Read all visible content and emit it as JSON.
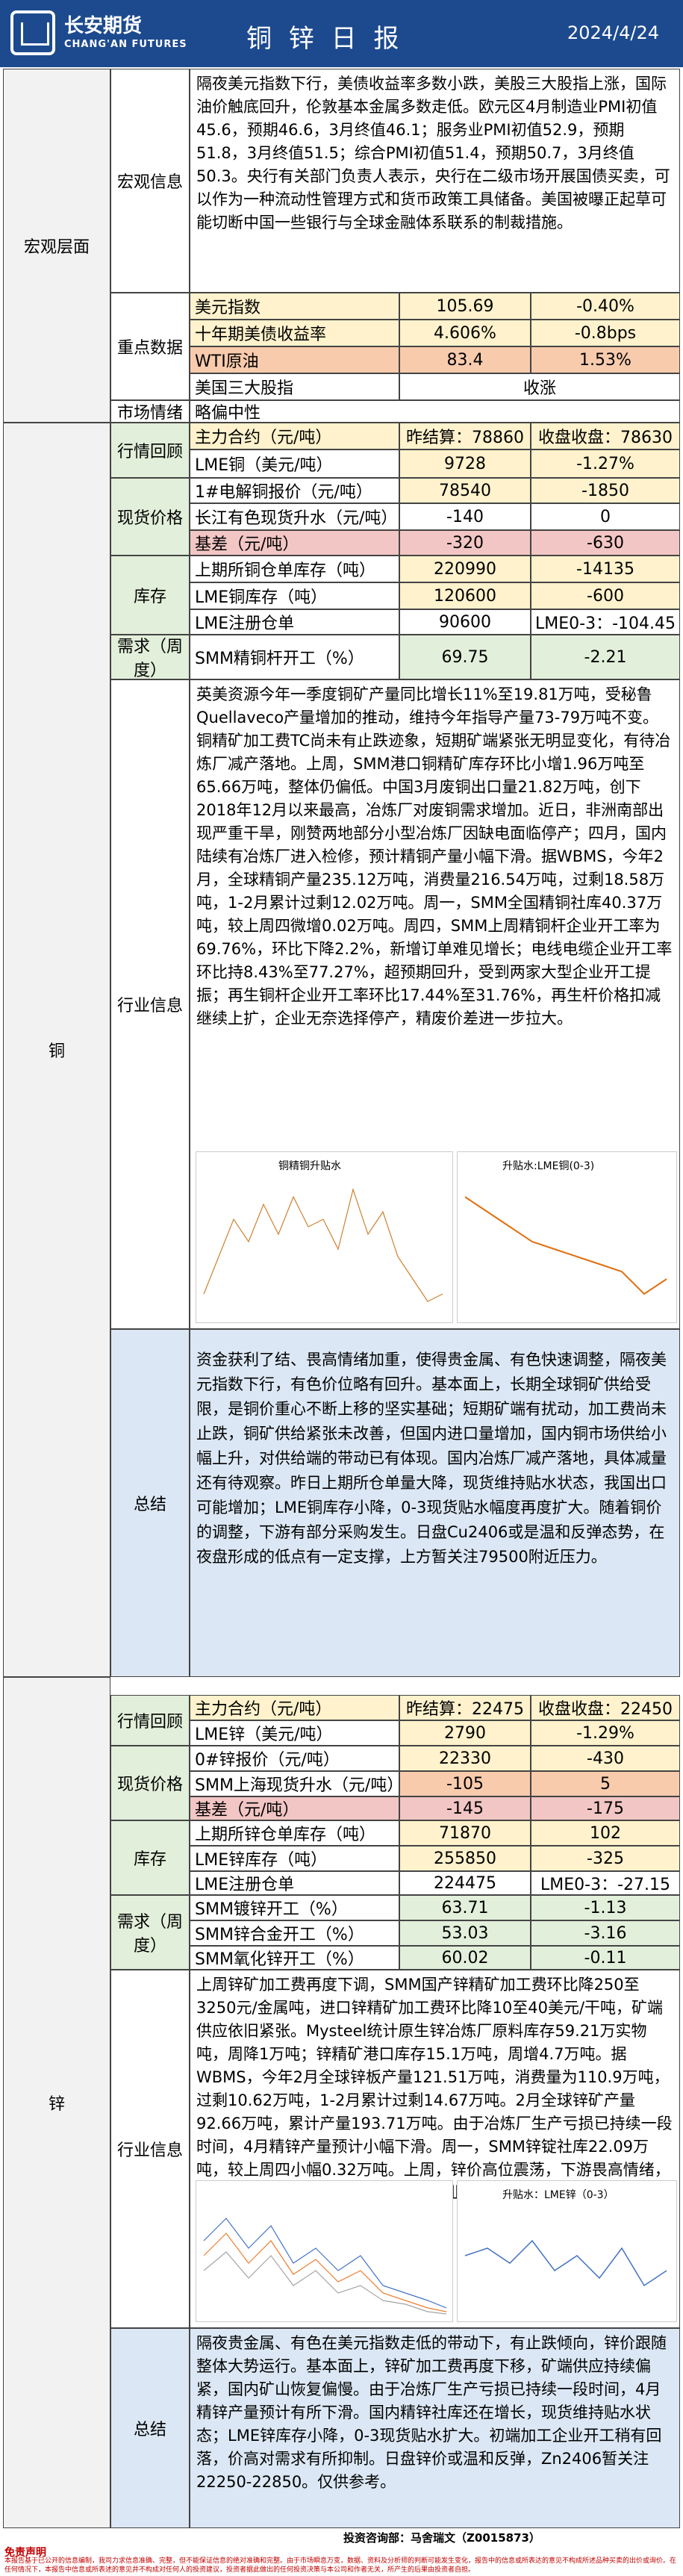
{
  "header": {
    "brand_cn": "长安期货",
    "brand_en": "CHANG'AN FUTURES",
    "title": "铜 锌 日 报",
    "date": "2024/4/24"
  },
  "macro": {
    "section": "宏观层面",
    "info_label": "宏观信息",
    "info_text": "隔夜美元指数下行，美债收益率多数小跌，美股三大股指上涨，国际油价触底回升，伦敦基本金属多数走低。欧元区4月制造业PMI初值45.6，预期46.6，3月终值46.1；服务业PMI初值52.9，预期51.8，3月终值51.5；综合PMI初值51.4，预期50.7，3月终值50.3。央行有关部门负责人表示，央行在二级市场开展国债买卖，可以作为一种流动性管理方式和货币政策工具储备。美国被曝正起草可能切断中国一些银行与全球金融体系联系的制裁措施。",
    "data_label": "重点数据",
    "rows": [
      {
        "name": "美元指数",
        "value": "105.69",
        "change": "-0.40%"
      },
      {
        "name": "十年期美债收益率",
        "value": "4.606%",
        "change": "-0.8bps"
      },
      {
        "name": "WTI原油",
        "value": "83.4",
        "change": "1.53%"
      },
      {
        "name": "美国三大股指",
        "value": "",
        "change": "收涨"
      }
    ],
    "sentiment_label": "市场情绪",
    "sentiment_value": "略偏中性"
  },
  "copper": {
    "section": "铜",
    "review_label": "行情回顾",
    "main_contract": "主力合约（元/吨）",
    "yclose_label": "昨结算：78860",
    "close_label": "收盘收盘：78630",
    "lme_label": "LME铜（美元/吨）",
    "lme_value": "9728",
    "lme_change": "-1.27%",
    "spot_label": "现货价格",
    "spot_rows": [
      {
        "name": "1#电解铜报价（元/吨）",
        "value": "78540",
        "change": "-1850"
      },
      {
        "name": "长江有色现货升水（元/吨）",
        "value": "-140",
        "change": "0"
      },
      {
        "name": "基差（元/吨）",
        "value": "-320",
        "change": "-630"
      }
    ],
    "stock_label": "库存",
    "stock_rows": [
      {
        "name": "上期所铜仓单库存（吨）",
        "value": "220990",
        "change": "-14135"
      },
      {
        "name": "LME铜库存（吨）",
        "value": "120600",
        "change": "-600"
      },
      {
        "name": "LME注册仓单",
        "value": "90600",
        "change": "LME0-3：-104.45"
      }
    ],
    "demand_label": "需求（周度）",
    "demand_rows": [
      {
        "name": "SMM精铜杆开工（%）",
        "value": "69.75",
        "change": "-2.21"
      }
    ],
    "industry_label": "行业信息",
    "industry_text": "英美资源今年一季度铜矿产量同比增长11%至19.81万吨，受秘鲁Quellaveco产量增加的推动，维持今年指导产量73-79万吨不变。铜精矿加工费TC尚未有止跌迹象，短期矿端紧张无明显变化，有待冶炼厂减产落地。上周，SMM港口铜精矿库存环比小增1.96万吨至65.66万吨，整体仍偏低。中国3月废铜出口量21.82万吨，创下2018年12月以来最高，冶炼厂对废铜需求增加。近日，非洲南部出现严重干旱，刚赞两地部分小型冶炼厂因缺电面临停产；四月，国内陆续有冶炼厂进入检修，预计精铜产量小幅下滑。据WBMS，今年2月，全球精铜产量235.12万吨，消费量216.54万吨，过剩18.58万吨，1-2月累计过剩12.02万吨。周一，SMM全国精铜社库40.37万吨，较上周四微增0.02万吨。周四，SMM上周精铜杆企业开工率为69.76%，环比下降2.2%，新增订单难见增长；电线电缆企业开工率环比持8.43%至77.27%，超预期回升，受到两家大型企业开工提振；再生铜杆企业开工率环比17.44%至31.76%，再生杆价格扣减继续上扩，企业无奈选择停产，精废价差进一步拉大。",
    "chart1_title": "铜精铜升贴水",
    "chart2_title": "升贴水:LME铜(0-3)",
    "summary_label": "总结",
    "summary_text": "资金获利了结、畏高情绪加重，使得贵金属、有色快速调整，隔夜美元指数下行，有色价位略有回升。基本面上，长期全球铜矿供给受限，是铜价重心不断上移的坚实基础；短期矿端有扰动，加工费尚未止跌，铜矿供给紧张未改善，但国内进口量增加，国内铜市场供给小幅上升，对供给端的带动已有体现。国内冶炼厂减产落地，具体减量还有待观察。昨日上期所仓单量大降，现货维持贴水状态，我国出口可能增加；LME铜库存小降，0-3现货贴水幅度再度扩大。随着铜价的调整，下游有部分采购发生。日盘Cu2406或是温和反弹态势，在夜盘形成的低点有一定支撑，上方暂关注79500附近压力。"
  },
  "zinc": {
    "section": "锌",
    "review_label": "行情回顾",
    "main_contract": "主力合约（元/吨）",
    "yclose_label": "昨结算：22475",
    "close_label": "收盘收盘：22450",
    "lme_label": "LME锌（美元/吨）",
    "lme_value": "2790",
    "lme_change": "-1.29%",
    "spot_label": "现货价格",
    "spot_rows": [
      {
        "name": "0#锌报价（元/吨）",
        "value": "22330",
        "change": "-430"
      },
      {
        "name": "SMM上海现货升水（元/吨）",
        "value": "-105",
        "change": "5"
      },
      {
        "name": "基差（元/吨）",
        "value": "-145",
        "change": "-175"
      }
    ],
    "stock_label": "库存",
    "stock_rows": [
      {
        "name": "上期所锌仓单库存（吨）",
        "value": "71870",
        "change": "102"
      },
      {
        "name": "LME锌库存（吨）",
        "value": "255850",
        "change": "-325"
      },
      {
        "name": "LME注册仓单",
        "value": "224475",
        "change": "LME0-3：-27.15"
      }
    ],
    "demand_label": "需求（周度）",
    "demand_rows": [
      {
        "name": "SMM镀锌开工（%）",
        "value": "63.71",
        "change": "-1.13"
      },
      {
        "name": "SMM锌合金开工（%）",
        "value": "53.03",
        "change": "-3.16"
      },
      {
        "name": "SMM氧化锌开工（%）",
        "value": "60.02",
        "change": "-0.11"
      }
    ],
    "industry_label": "行业信息",
    "industry_text": "上周锌矿加工费再度下调，SMM国产锌精矿加工费环比降250至3250元/金属吨，进口锌精矿加工费环比降10至40美元/干吨，矿端供应依旧紧张。Mysteel统计原生锌冶炼厂原料库存59.21万实物吨，周降1万吨；锌精矿港口库存15.1万吨，周增4.7万吨。据WBMS，今年2月全球锌板产量121.51万吨，消费量为110.9万吨，过剩10.62万吨，1-2月累计过剩14.67万吨。2月全球锌矿产量92.66万吨，累计产量193.71万吨。由于冶炼厂生产亏损已持续一段时间，4月精锌产量预计小幅下滑。周一，SMM锌锭社库22.09万吨，较上周四小幅0.32万吨。上周，锌价高位震荡，下游畏高情绪，终端采买积极性也不高，初端加工企业开工小幅下降。",
    "chart1_title": "",
    "chart2_title": "升贴水：LME锌（0-3）",
    "summary_label": "总结",
    "summary_text": "隔夜贵金属、有色在美元指数走低的带动下，有止跌倾向，锌价跟随整体大势运行。基本面上，锌矿加工费再度下移，矿端供应持续偏紧，国内矿山恢复偏慢。由于冶炼厂生产亏损已持续一段时间，4月精锌产量预计有所下滑。国内精锌社库还在增长，现货维持贴水状态；LME锌库存小降，0-3现货贴水扩大。初端加工企业开工稍有回落，价高对需求有所抑制。日盘锌价或温和反弹，Zn2406暂关注22250-22850。仅供参考。"
  },
  "footer": {
    "contact": "投资咨询部：马舍瑞文（Z0015873）",
    "disclaimer_title": "免责声明",
    "disclaimer": "本报告基于已公开的信息编制，我司力求信息准确、完整，但不能保证信息的绝对准确和完整。由于市场瞬息万变，数据、资料及分析师的判断可能发生变化，报告中的信息或所表达的意见不构成所述品种买卖的出价或询价。在任何情况下，本报告中信息或所表述的意见并不构成对任何人的投资建议，投资者据此做出的任何投资决策与本公司和作者无关，所产生的后果由投资者自担。"
  },
  "colors": {
    "header": "#1d4a8e",
    "yellow": "#fff2cc",
    "green": "#e2efda",
    "blue": "#dbe7f4",
    "pink": "#f2c6c4",
    "orange": "#f8cbad"
  }
}
